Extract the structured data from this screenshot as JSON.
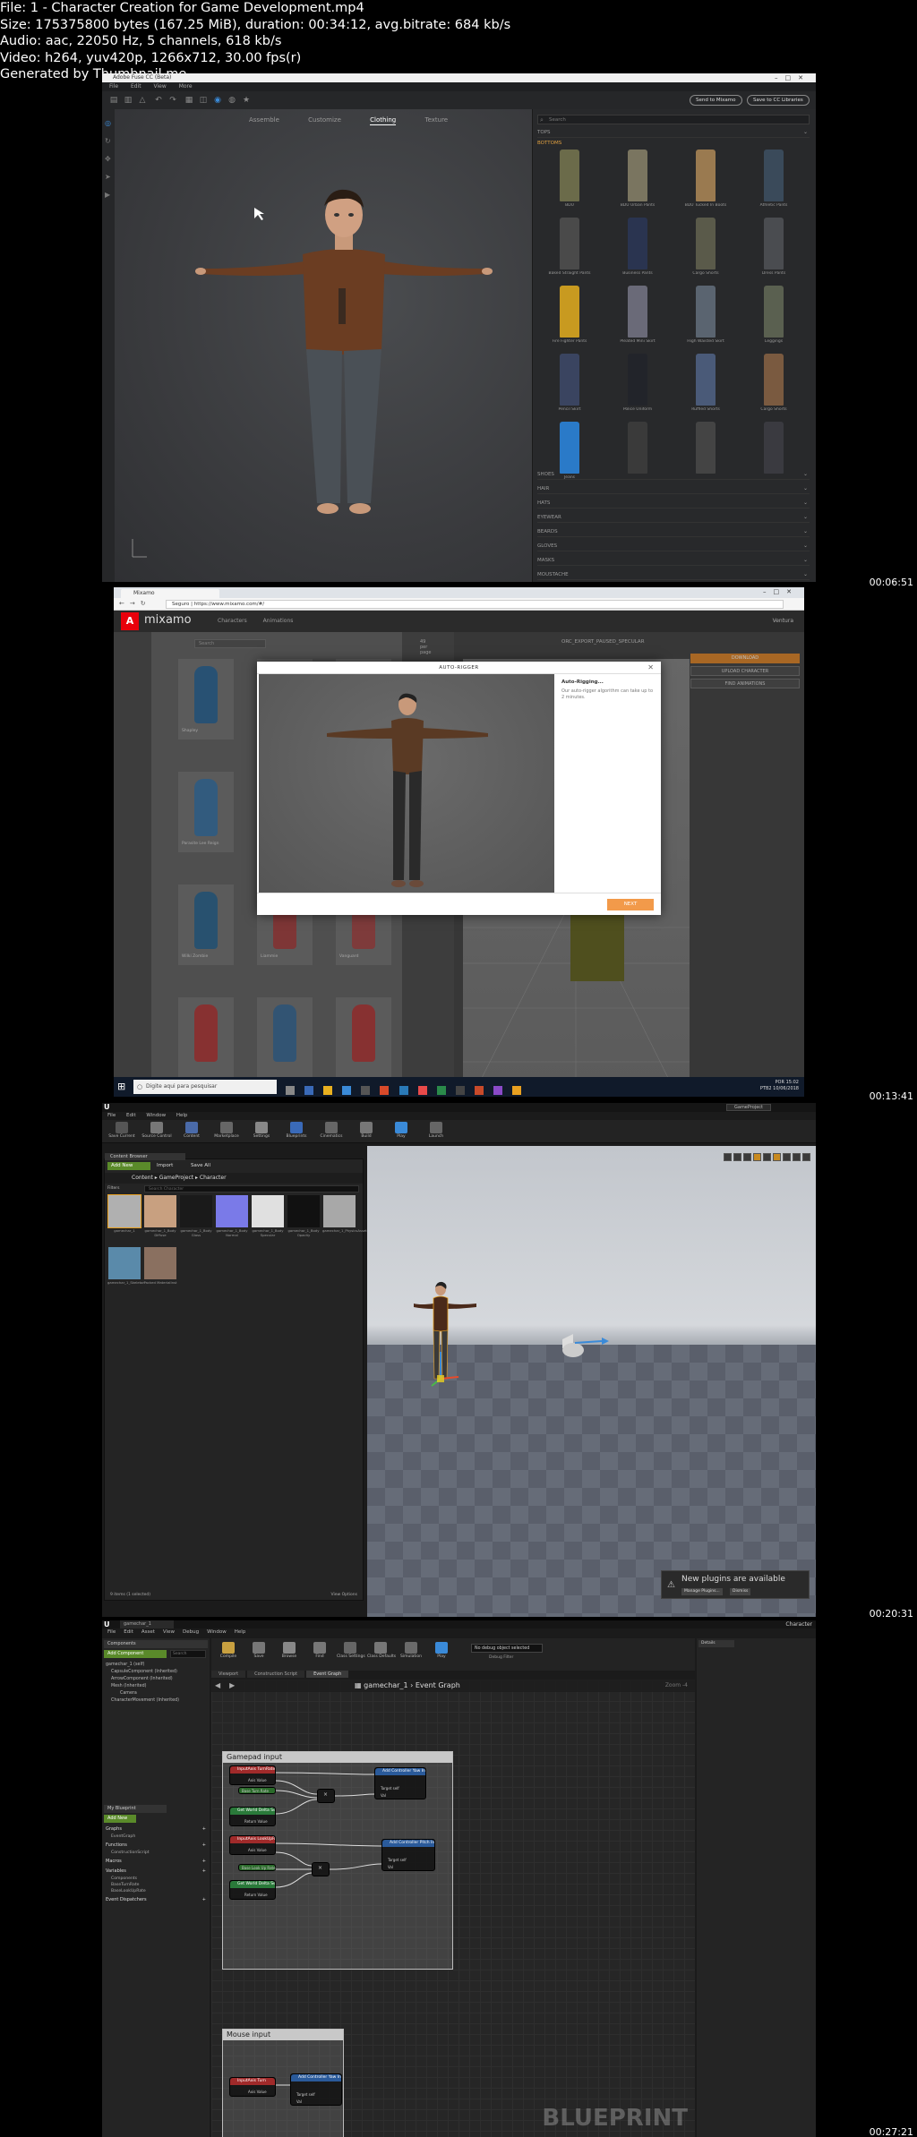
{
  "header": {
    "line1": "File: 1 - Character Creation for Game Development.mp4",
    "line2": "Size: 175375800 bytes (167.25 MiB), duration: 00:34:12, avg.bitrate: 684 kb/s",
    "line3": "Audio: aac, 22050 Hz, 5 channels, 618 kb/s",
    "line4": "Video: h264, yuv420p, 1266x712, 30.00 fps(r)",
    "line5": "Generated by Thumbnail me"
  },
  "timestamps": [
    "00:06:51",
    "00:13:41",
    "00:20:31",
    "00:27:21"
  ],
  "fuse": {
    "window_title": "Adobe Fuse CC (Beta)",
    "menu": [
      "File",
      "Edit",
      "View",
      "More"
    ],
    "send_btn": "Send to Mixamo",
    "save_btn": "Save to CC Libraries",
    "tabs": [
      "Assemble",
      "Customize",
      "Clothing",
      "Texture"
    ],
    "search_placeholder": "Search",
    "categories": [
      "TOPS",
      "BOTTOMS",
      "SHOES",
      "HAIR",
      "HATS",
      "EYEWEAR",
      "BEARDS",
      "GLOVES",
      "MASKS",
      "MOUSTACHE"
    ],
    "pants": [
      {
        "name": "BDU",
        "color": "#6b6b4a"
      },
      {
        "name": "BDU Urban Pants",
        "color": "#7a7560"
      },
      {
        "name": "BDU Tucked In Boots",
        "color": "#9a7a50"
      },
      {
        "name": "Athletic Pants",
        "color": "#3a4a5a"
      },
      {
        "name": "Baked Straight Pants",
        "color": "#4a4a4a"
      },
      {
        "name": "Business Pants",
        "color": "#2a3450"
      },
      {
        "name": "Cargo Shorts",
        "color": "#5a5a4a"
      },
      {
        "name": "Dress Pants",
        "color": "#4a4c50"
      },
      {
        "name": "Fire Fighter Pants",
        "color": "#c89a20"
      },
      {
        "name": "Pleated Mini Skirt",
        "color": "#6a6a78"
      },
      {
        "name": "High Waisted Skirt",
        "color": "#5a6470"
      },
      {
        "name": "Leggings",
        "color": "#5a6050"
      },
      {
        "name": "Pencil Skirt",
        "color": "#3a4460"
      },
      {
        "name": "Police Uniform",
        "color": "#22242a"
      },
      {
        "name": "Ruffled Shorts",
        "color": "#4a5a78"
      },
      {
        "name": "Cargo Shorts",
        "color": "#7a5a40"
      },
      {
        "name": "Jeans",
        "color": "#2a7ac8"
      },
      {
        "name": "",
        "color": "#3a3a3a"
      },
      {
        "name": "",
        "color": "#444"
      },
      {
        "name": "",
        "color": "#3a3a40"
      }
    ]
  },
  "mixamo": {
    "tab_title": "Mixamo",
    "url": "Seguro | https://www.mixamo.com/#/",
    "brand": "mixamo",
    "menu": [
      "Characters",
      "Animations"
    ],
    "user": "Ventura",
    "search_placeholder": "Search",
    "pager": "49 per page",
    "preview_name": "ORC_EXPORT_PAUSED_SPECULAR",
    "btn_download": "DOWNLOAD",
    "btn_upload": "UPLOAD CHARACTER",
    "btn_find": "FIND ANIMATIONS",
    "modal_title": "AUTO-RIGGER",
    "modal_heading": "Auto-Rigging...",
    "modal_text": "Our auto-rigger algorithm can take up to 2 minutes.",
    "modal_next": "NEXT",
    "characters": [
      {
        "name": "Shapley",
        "color": "#2a6aa0"
      },
      {
        "name": "",
        "color": "#2a6aa0"
      },
      {
        "name": "",
        "color": "#2a6aa0"
      },
      {
        "name": "Parasite Lee Reign",
        "color": "#3a7ab0"
      },
      {
        "name": "",
        "color": "#3a7ab0"
      },
      {
        "name": "",
        "color": "#3a7ab0"
      },
      {
        "name": "Wilki Zombie",
        "color": "#2a6a9a"
      },
      {
        "name": "Liammie",
        "color": "#b04040"
      },
      {
        "name": "Vanguard",
        "color": "#b04848"
      },
      {
        "name": "",
        "color": "#c03838"
      },
      {
        "name": "",
        "color": "#3a70a0"
      },
      {
        "name": "",
        "color": "#c03838"
      }
    ],
    "taskbar_search": "Digite aqui para pesquisar",
    "tray_lang": "POR",
    "tray_kb": "PTB2",
    "tray_time": "15:02",
    "tray_date": "10/06/2018"
  },
  "unreal": {
    "project": "GameProject",
    "menu": [
      "File",
      "Edit",
      "Window",
      "Help"
    ],
    "toolbar": [
      "Save Current",
      "Source Control",
      "Content",
      "Marketplace",
      "Settings",
      "Blueprints",
      "Cinematics",
      "Build",
      "Play",
      "Launch"
    ],
    "cb_tab": "Content Browser",
    "add_new": "Add New",
    "import": "Import",
    "save_all": "Save All",
    "breadcrumb": [
      "Content",
      "GameProject",
      "Character"
    ],
    "filters": "Filters",
    "search_placeholder": "Search Character",
    "assets": [
      {
        "name": "gamechar_1",
        "color": "#b0b0b0"
      },
      {
        "name": "gamechar_1_Body Diffuse",
        "color": "#c8a080"
      },
      {
        "name": "gamechar_1_Body Gloss",
        "color": "#1a1a1a"
      },
      {
        "name": "gamechar_1_Body Normal",
        "color": "#7a7ae8"
      },
      {
        "name": "gamechar_1_Body Specular",
        "color": "#e0e0e0"
      },
      {
        "name": "gamechar_1_Body Opacity",
        "color": "#111"
      },
      {
        "name": "gamechar_1_PhysicsAsset",
        "color": "#a8a8a8"
      },
      {
        "name": "gamechar_1_Skeleton",
        "color": "#5a8aaa"
      },
      {
        "name": "Packed MaterialInst",
        "color": "#8a7060"
      }
    ],
    "footer_items": "9 items (1 selected)",
    "view_options": "View Options",
    "toast_title": "New plugins are available",
    "toast_btn1": "Manage Plugins...",
    "toast_btn2": "Dismiss"
  },
  "blueprint": {
    "tab": "gamechar_1",
    "char_label": "Character",
    "menu": [
      "File",
      "Edit",
      "Asset",
      "View",
      "Debug",
      "Window",
      "Help"
    ],
    "components": "Components",
    "add_component": "Add Component",
    "search": "Search",
    "tree": [
      "gamechar_1 (self)",
      "CapsuleComponent (Inherited)",
      "ArrowComponent (Inherited)",
      "Mesh (Inherited)",
      "Camera",
      "CharacterMovement (Inherited)"
    ],
    "my_blueprint": "My Blueprint",
    "add_new": "Add New",
    "sections": [
      {
        "label": "Graphs",
        "subs": [
          "EventGraph"
        ]
      },
      {
        "label": "Functions",
        "subs": [
          "ConstructionScript"
        ]
      },
      {
        "label": "Macros",
        "subs": []
      },
      {
        "label": "Variables",
        "subs": [
          "Components",
          "BaseTurnRate",
          "BaseLookUpRate"
        ]
      },
      {
        "label": "Event Dispatchers",
        "subs": []
      }
    ],
    "toolbar": [
      "Compile",
      "Save",
      "Browse",
      "Find",
      "Class Settings",
      "Class Defaults",
      "Simulation",
      "Play"
    ],
    "debug_filter": "No debug object selected",
    "debug_label": "Debug Filter",
    "graph_tabs": [
      "Viewport",
      "Construction Script",
      "Event Graph"
    ],
    "crumb_root": "gamechar_1",
    "crumb_leaf": "Event Graph",
    "zoom": "Zoom -4",
    "details": "Details",
    "comment1": "Gamepad input",
    "comment2": "Mouse input",
    "nodes": {
      "turn_rate": "InputAxis TurnRate",
      "axis_value": "Axis Value",
      "base_turn": "Base Turn Rate",
      "world_delta": "Get World Delta Seconds",
      "return_value": "Return Value",
      "add_yaw": "Add Controller Yaw Input",
      "target_self": "Target self",
      "val": "Val",
      "lookup_rate": "InputAxis LookUpRate",
      "base_lookup": "Base Look Up Rate",
      "add_pitch": "Add Controller Pitch Input",
      "turn": "InputAxis Turn",
      "multiply": "Multiply"
    },
    "watermark": "BLUEPRINT"
  }
}
